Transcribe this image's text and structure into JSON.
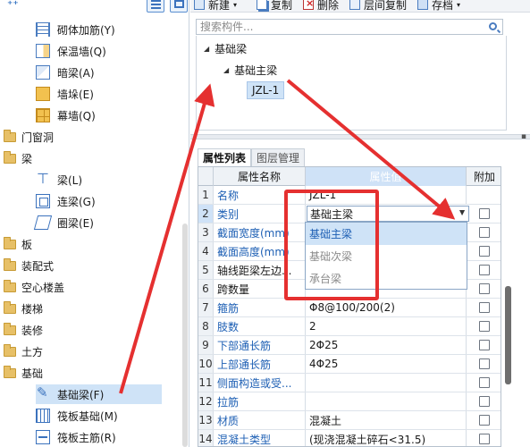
{
  "left_panel": {
    "corner_glyph": "⁺⁺",
    "categories": [
      {
        "label": "门窗洞"
      },
      {
        "label": "梁"
      },
      {
        "label": "板"
      },
      {
        "label": "装配式"
      },
      {
        "label": "空心楼盖"
      },
      {
        "label": "楼梯"
      },
      {
        "label": "装修"
      },
      {
        "label": "土方"
      },
      {
        "label": "基础"
      }
    ],
    "wall_items": [
      {
        "label": "砌体加筋(Y)",
        "icon": "rebar-icon"
      },
      {
        "label": "保温墙(Q)",
        "icon": "insulation-wall-icon"
      },
      {
        "label": "暗梁(A)",
        "icon": "hidden-beam-icon"
      },
      {
        "label": "墙垛(E)",
        "icon": "buttress-icon"
      },
      {
        "label": "幕墙(Q)",
        "icon": "curtain-wall-icon"
      }
    ],
    "beam_items": [
      {
        "label": "梁(L)",
        "icon": "beam-icon"
      },
      {
        "label": "连梁(G)",
        "icon": "link-beam-icon"
      },
      {
        "label": "圈梁(E)",
        "icon": "ring-beam-icon"
      }
    ],
    "foundation_items": [
      {
        "label": "基础梁(F)",
        "icon": "foundation-beam-icon",
        "selected": true
      },
      {
        "label": "筏板基础(M)",
        "icon": "raft-foundation-icon"
      },
      {
        "label": "筏板主筋(R)",
        "icon": "raft-rebar-icon"
      }
    ]
  },
  "toolbar": {
    "new_label": "新建",
    "copy_label": "复制",
    "delete_label": "删除",
    "layer_copy_label": "层间复制",
    "save_label": "存档"
  },
  "search": {
    "placeholder": "搜索构件..."
  },
  "component_tree": {
    "root": "基础梁",
    "child": "基础主梁",
    "leaf": "JZL-1"
  },
  "tabs": [
    {
      "label": "属性列表",
      "active": true
    },
    {
      "label": "图层管理",
      "active": false
    }
  ],
  "property_grid": {
    "headers": {
      "name": "属性名称",
      "value": "属性值",
      "add": "附加"
    },
    "rows": [
      {
        "num": "1",
        "name": "名称",
        "value": "JZL-1",
        "link": true,
        "checkbox": false
      },
      {
        "num": "2",
        "name": "类别",
        "value": "基础主梁",
        "link": true,
        "checkbox": true
      },
      {
        "num": "3",
        "name": "截面宽度(mm)",
        "value": "",
        "link": true,
        "checkbox": true
      },
      {
        "num": "4",
        "name": "截面高度(mm)",
        "value": "",
        "link": true,
        "checkbox": true
      },
      {
        "num": "5",
        "name": "轴线距梁左边...",
        "value": "",
        "link": false,
        "checkbox": true
      },
      {
        "num": "6",
        "name": "跨数量",
        "value": "",
        "link": false,
        "checkbox": true
      },
      {
        "num": "7",
        "name": "箍筋",
        "value": "Φ8@100/200(2)",
        "link": true,
        "checkbox": true
      },
      {
        "num": "8",
        "name": "肢数",
        "value": "2",
        "link": true,
        "checkbox": true
      },
      {
        "num": "9",
        "name": "下部通长筋",
        "value": "2Φ25",
        "link": true,
        "checkbox": true
      },
      {
        "num": "10",
        "name": "上部通长筋",
        "value": "4Φ25",
        "link": true,
        "checkbox": true
      },
      {
        "num": "11",
        "name": "侧面构造或受...",
        "value": "",
        "link": true,
        "checkbox": true
      },
      {
        "num": "12",
        "name": "拉筋",
        "value": "",
        "link": true,
        "checkbox": true
      },
      {
        "num": "13",
        "name": "材质",
        "value": "混凝土",
        "link": true,
        "checkbox": true
      },
      {
        "num": "14",
        "name": "混凝土类型",
        "value": "(现浇混凝土碎石<31.5)",
        "link": true,
        "checkbox": true
      }
    ],
    "dropdown_options": [
      {
        "label": "基础主梁",
        "highlighted": true
      },
      {
        "label": "基础次梁",
        "highlighted": false
      },
      {
        "label": "承台梁",
        "highlighted": false
      }
    ]
  },
  "colors": {
    "annotation": "#e53030",
    "selection": "#cfe3f7",
    "link_text": "#1d5fb4"
  }
}
